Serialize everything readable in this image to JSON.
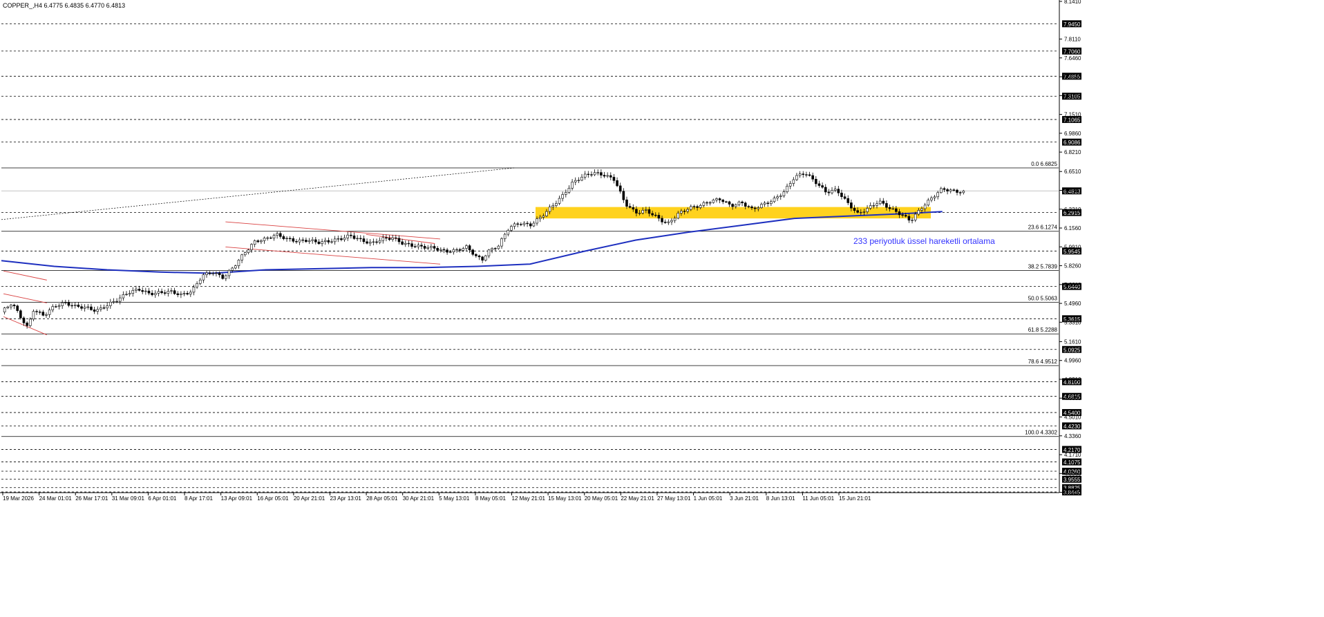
{
  "header": {
    "symbol_info": "COPPER_,H4  6.4775 6.4835 6.4770 6.4813"
  },
  "annotation": {
    "ema_label": "233 periyotluk üssel hareketli ortalama"
  },
  "colors": {
    "background": "#ffffff",
    "text": "#000000",
    "ema": "#1d2fbf",
    "channel": "#d94040",
    "zone": "#ffd21e",
    "ema_label": "#3333ff"
  },
  "chart_data": {
    "type": "candlestick",
    "title": "COPPER_,H4",
    "ohlc_header": {
      "open": 6.4775,
      "high": 6.4835,
      "low": 6.477,
      "close": 6.4813
    },
    "ylim": [
      3.8445,
      8.141
    ],
    "price_axis_ticks": [
      8.141,
      7.811,
      7.646,
      7.481,
      7.316,
      7.151,
      6.986,
      6.821,
      6.651,
      6.486,
      6.321,
      6.156,
      5.991,
      5.826,
      5.661,
      5.496,
      5.331,
      5.161,
      4.996,
      4.831,
      4.666,
      4.501,
      4.336,
      4.171,
      4.006,
      3.841
    ],
    "time_axis_labels": [
      "19 Mar 2026",
      "24 Mar 01:01",
      "26 Mar 17:01",
      "31 Mar 09:01",
      "6 Apr 01:01",
      "8 Apr 17:01",
      "13 Apr 09:01",
      "16 Apr 05:01",
      "20 Apr 21:01",
      "23 Apr 13:01",
      "28 Apr 05:01",
      "30 Apr 21:01",
      "5 May 13:01",
      "8 May 05:01",
      "12 May 21:01",
      "15 May 13:01",
      "20 May 05:01",
      "22 May 21:01",
      "27 May 13:01",
      "1 Jun 05:01",
      "3 Jun 21:01",
      "8 Jun 13:01",
      "11 Jun 05:01",
      "15 Jun 21:01"
    ],
    "dashed_levels": [
      7.945,
      7.706,
      7.4855,
      7.3105,
      7.1065,
      6.9086,
      6.2915,
      5.9545,
      5.644,
      5.3615,
      5.0925,
      4.81,
      4.6815,
      4.54,
      4.423,
      4.217,
      4.1075,
      4.026,
      3.9555,
      3.8825,
      3.8445
    ],
    "current_price": 6.4813,
    "fibonacci": [
      {
        "label": "0.0",
        "price": 6.6825
      },
      {
        "label": "23.6",
        "price": 6.1274
      },
      {
        "label": "38.2",
        "price": 5.7839
      },
      {
        "label": "50.0",
        "price": 5.5063
      },
      {
        "label": "61.8",
        "price": 5.2288
      },
      {
        "label": "78.6",
        "price": 4.9512
      },
      {
        "label": "100.0",
        "price": 4.3302
      }
    ],
    "support_zone": {
      "low": 6.24,
      "high": 6.34
    },
    "ema_period": 233,
    "ema_points": [
      [
        0,
        5.87
      ],
      [
        0.05,
        5.82
      ],
      [
        0.1,
        5.79
      ],
      [
        0.15,
        5.77
      ],
      [
        0.2,
        5.76
      ],
      [
        0.25,
        5.79
      ],
      [
        0.3,
        5.8
      ],
      [
        0.35,
        5.81
      ],
      [
        0.4,
        5.81
      ],
      [
        0.45,
        5.82
      ],
      [
        0.5,
        5.84
      ],
      [
        0.55,
        5.95
      ],
      [
        0.6,
        6.05
      ],
      [
        0.65,
        6.12
      ],
      [
        0.7,
        6.18
      ],
      [
        0.75,
        6.24
      ],
      [
        0.8,
        6.26
      ],
      [
        0.85,
        6.28
      ],
      [
        0.89,
        6.3
      ]
    ],
    "price_path": [
      [
        0,
        5.42
      ],
      [
        0.01,
        5.5
      ],
      [
        0.02,
        5.35
      ],
      [
        0.025,
        5.28
      ],
      [
        0.03,
        5.44
      ],
      [
        0.04,
        5.39
      ],
      [
        0.05,
        5.47
      ],
      [
        0.06,
        5.5
      ],
      [
        0.07,
        5.47
      ],
      [
        0.08,
        5.46
      ],
      [
        0.09,
        5.43
      ],
      [
        0.1,
        5.48
      ],
      [
        0.11,
        5.53
      ],
      [
        0.12,
        5.59
      ],
      [
        0.13,
        5.62
      ],
      [
        0.14,
        5.58
      ],
      [
        0.15,
        5.59
      ],
      [
        0.16,
        5.6
      ],
      [
        0.17,
        5.57
      ],
      [
        0.18,
        5.6
      ],
      [
        0.19,
        5.74
      ],
      [
        0.2,
        5.77
      ],
      [
        0.21,
        5.72
      ],
      [
        0.22,
        5.82
      ],
      [
        0.23,
        5.94
      ],
      [
        0.24,
        6.04
      ],
      [
        0.25,
        6.06
      ],
      [
        0.26,
        6.1
      ],
      [
        0.27,
        6.06
      ],
      [
        0.28,
        6.04
      ],
      [
        0.29,
        6.05
      ],
      [
        0.3,
        6.03
      ],
      [
        0.31,
        6.04
      ],
      [
        0.32,
        6.06
      ],
      [
        0.33,
        6.09
      ],
      [
        0.34,
        6.05
      ],
      [
        0.35,
        6.02
      ],
      [
        0.36,
        6.06
      ],
      [
        0.37,
        6.07
      ],
      [
        0.38,
        6.02
      ],
      [
        0.39,
        6.0
      ],
      [
        0.4,
        5.99
      ],
      [
        0.41,
        5.98
      ],
      [
        0.42,
        5.95
      ],
      [
        0.43,
        5.96
      ],
      [
        0.44,
        5.99
      ],
      [
        0.45,
        5.9
      ],
      [
        0.455,
        5.88
      ],
      [
        0.46,
        5.95
      ],
      [
        0.47,
        6.0
      ],
      [
        0.48,
        6.16
      ],
      [
        0.49,
        6.2
      ],
      [
        0.5,
        6.18
      ],
      [
        0.51,
        6.25
      ],
      [
        0.52,
        6.34
      ],
      [
        0.53,
        6.43
      ],
      [
        0.54,
        6.55
      ],
      [
        0.55,
        6.61
      ],
      [
        0.56,
        6.64
      ],
      [
        0.57,
        6.62
      ],
      [
        0.58,
        6.58
      ],
      [
        0.59,
        6.37
      ],
      [
        0.6,
        6.29
      ],
      [
        0.61,
        6.31
      ],
      [
        0.62,
        6.25
      ],
      [
        0.63,
        6.19
      ],
      [
        0.64,
        6.28
      ],
      [
        0.65,
        6.33
      ],
      [
        0.66,
        6.35
      ],
      [
        0.67,
        6.39
      ],
      [
        0.68,
        6.41
      ],
      [
        0.69,
        6.35
      ],
      [
        0.7,
        6.38
      ],
      [
        0.71,
        6.32
      ],
      [
        0.72,
        6.36
      ],
      [
        0.73,
        6.4
      ],
      [
        0.74,
        6.47
      ],
      [
        0.75,
        6.6
      ],
      [
        0.76,
        6.64
      ],
      [
        0.77,
        6.56
      ],
      [
        0.78,
        6.47
      ],
      [
        0.79,
        6.49
      ],
      [
        0.8,
        6.38
      ],
      [
        0.81,
        6.28
      ],
      [
        0.82,
        6.33
      ],
      [
        0.83,
        6.39
      ],
      [
        0.84,
        6.33
      ],
      [
        0.85,
        6.28
      ],
      [
        0.86,
        6.22
      ],
      [
        0.87,
        6.33
      ],
      [
        0.88,
        6.42
      ],
      [
        0.89,
        6.5
      ],
      [
        0.9,
        6.48
      ],
      [
        0.91,
        6.47
      ]
    ]
  }
}
